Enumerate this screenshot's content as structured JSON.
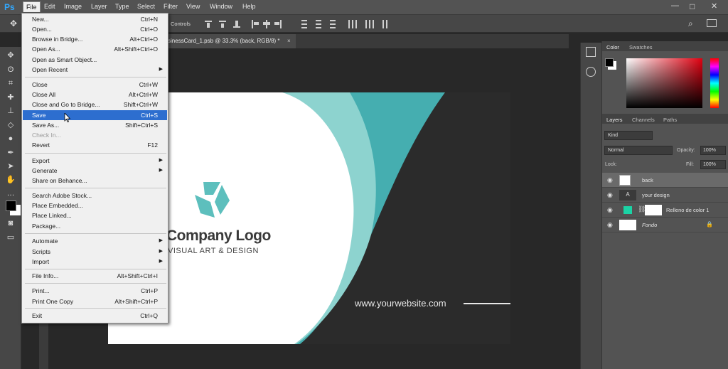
{
  "app": {
    "logo": "Ps"
  },
  "menubar": [
    "File",
    "Edit",
    "Image",
    "Layer",
    "Type",
    "Select",
    "Filter",
    "View",
    "Window",
    "Help"
  ],
  "window_controls": {
    "minimize": "—",
    "restore": "□",
    "close": "✕"
  },
  "options": {
    "show_transform": "Controls"
  },
  "document_tab": {
    "title": "sinessCard_1.psb @ 33.3% (back, RGB/8) *",
    "close": "×"
  },
  "file_menu": [
    {
      "label": "New...",
      "shortcut": "Ctrl+N"
    },
    {
      "label": "Open...",
      "shortcut": "Ctrl+O"
    },
    {
      "label": "Browse in Bridge...",
      "shortcut": "Alt+Ctrl+O"
    },
    {
      "label": "Open As...",
      "shortcut": "Alt+Shift+Ctrl+O"
    },
    {
      "label": "Open as Smart Object...",
      "shortcut": ""
    },
    {
      "label": "Open Recent",
      "shortcut": "",
      "submenu": true
    },
    {
      "label": "Close",
      "shortcut": "Ctrl+W"
    },
    {
      "label": "Close All",
      "shortcut": "Alt+Ctrl+W"
    },
    {
      "label": "Close and Go to Bridge...",
      "shortcut": "Shift+Ctrl+W"
    },
    {
      "label": "Save",
      "shortcut": "Ctrl+S",
      "highlighted": true
    },
    {
      "label": "Save As...",
      "shortcut": "Shift+Ctrl+S"
    },
    {
      "label": "Check In...",
      "shortcut": "",
      "disabled": true
    },
    {
      "label": "Revert",
      "shortcut": "F12"
    },
    {
      "label": "Export",
      "shortcut": "",
      "submenu": true
    },
    {
      "label": "Generate",
      "shortcut": "",
      "submenu": true
    },
    {
      "label": "Share on Behance...",
      "shortcut": ""
    },
    {
      "label": "Search Adobe Stock...",
      "shortcut": ""
    },
    {
      "label": "Place Embedded...",
      "shortcut": ""
    },
    {
      "label": "Place Linked...",
      "shortcut": ""
    },
    {
      "label": "Package...",
      "shortcut": ""
    },
    {
      "label": "Automate",
      "shortcut": "",
      "submenu": true
    },
    {
      "label": "Scripts",
      "shortcut": "",
      "submenu": true
    },
    {
      "label": "Import",
      "shortcut": "",
      "submenu": true
    },
    {
      "label": "File Info...",
      "shortcut": "Alt+Shift+Ctrl+I"
    },
    {
      "label": "Print...",
      "shortcut": "Ctrl+P"
    },
    {
      "label": "Print One Copy",
      "shortcut": "Alt+Shift+Ctrl+P"
    },
    {
      "label": "Exit",
      "shortcut": "Ctrl+Q"
    }
  ],
  "card": {
    "company": "Company Logo",
    "tagline": "VISUAL ART & DESIGN",
    "website": "www.yourwebsite.com",
    "accent": "#5dbfbd",
    "accent_light": "#8dd3cf",
    "accent_dark": "#45aeb0"
  },
  "color_panel": {
    "tabs": [
      "Color",
      "Swatches"
    ]
  },
  "layers_panel": {
    "tabs": [
      "Layers",
      "Channels",
      "Paths"
    ],
    "filter_kind": "Kind",
    "blend_mode": "Normal",
    "opacity_label": "Opacity:",
    "opacity": "100%",
    "lock_label": "Lock:",
    "fill_label": "Fill:",
    "fill": "100%",
    "layers": [
      {
        "name": "back",
        "type": "smart",
        "selected": true
      },
      {
        "name": "your design",
        "type": "text"
      },
      {
        "name": "Relleno de color 1",
        "type": "fill"
      },
      {
        "name": "Fondo",
        "type": "background",
        "locked": true
      }
    ]
  },
  "icons": [
    "photoshop-logo",
    "move-icon",
    "search-icon",
    "workspace-icon",
    "eye-icon",
    "lock-icon",
    "chain-icon",
    "submenu-arrow-icon",
    "cursor-icon"
  ]
}
